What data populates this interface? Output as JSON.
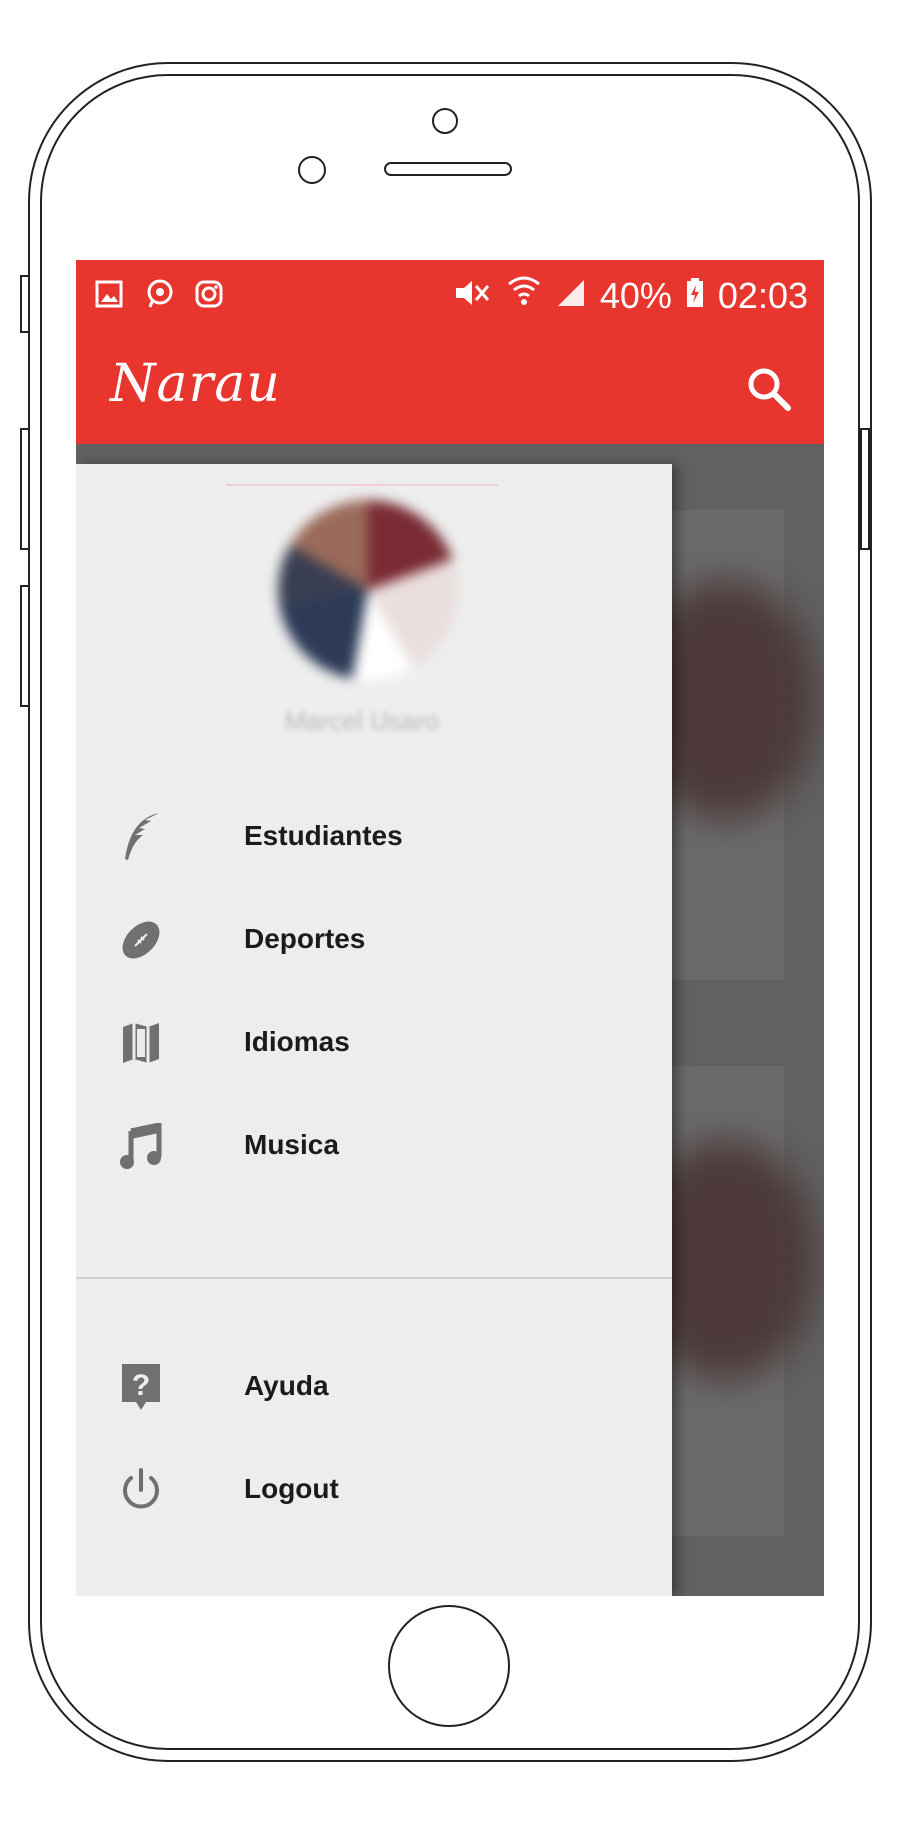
{
  "status_bar": {
    "left_icons": [
      "image-icon",
      "chat-icon",
      "instagram-icon"
    ],
    "right_icons": [
      "mute-icon",
      "wifi-icon",
      "signal-icon"
    ],
    "battery": "40%",
    "time": "02:03"
  },
  "app_bar": {
    "logo": "Narau",
    "search_icon": "search-icon",
    "color": "#e8352d"
  },
  "drawer": {
    "profile_name": "Marcel Usaro",
    "menu": [
      {
        "label": "Estudiantes",
        "icon": "feather-icon"
      },
      {
        "label": "Deportes",
        "icon": "football-icon"
      },
      {
        "label": "Idiomas",
        "icon": "map-icon"
      },
      {
        "label": "Musica",
        "icon": "music-note-icon"
      }
    ],
    "secondary_menu": [
      {
        "label": "Ayuda",
        "icon": "help-icon"
      },
      {
        "label": "Logout",
        "icon": "power-icon"
      }
    ]
  }
}
